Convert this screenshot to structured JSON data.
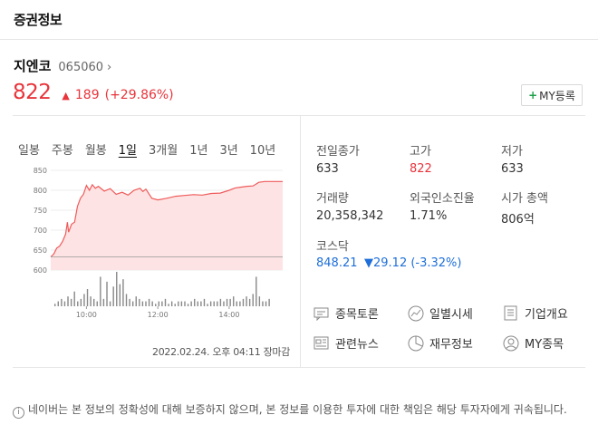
{
  "header": {
    "title": "증권정보"
  },
  "stock": {
    "name": "지엔코",
    "code": "065060",
    "chevron": "›",
    "price": "822",
    "direction_icon": "▲",
    "change": "189",
    "change_pct": "(+29.86%)",
    "my_button": "MY등록",
    "my_button_plus": "+"
  },
  "tabs": [
    "일봉",
    "주봉",
    "월봉",
    "1일",
    "3개월",
    "1년",
    "3년",
    "10년"
  ],
  "active_tab": "1일",
  "chart_data": {
    "type": "area",
    "y_ticks": [
      "850",
      "800",
      "750",
      "700",
      "650",
      "600"
    ],
    "x_ticks": [
      "10:00",
      "12:00",
      "14:00"
    ],
    "ylim": [
      600,
      850
    ],
    "baseline": 633,
    "price_series": [
      {
        "t": "09:00",
        "v": 633
      },
      {
        "t": "09:05",
        "v": 640
      },
      {
        "t": "09:10",
        "v": 655
      },
      {
        "t": "09:15",
        "v": 660
      },
      {
        "t": "09:20",
        "v": 672
      },
      {
        "t": "09:25",
        "v": 690
      },
      {
        "t": "09:28",
        "v": 720
      },
      {
        "t": "09:30",
        "v": 695
      },
      {
        "t": "09:35",
        "v": 715
      },
      {
        "t": "09:40",
        "v": 720
      },
      {
        "t": "09:45",
        "v": 760
      },
      {
        "t": "09:50",
        "v": 780
      },
      {
        "t": "09:55",
        "v": 790
      },
      {
        "t": "10:00",
        "v": 812
      },
      {
        "t": "10:05",
        "v": 800
      },
      {
        "t": "10:10",
        "v": 814
      },
      {
        "t": "10:15",
        "v": 805
      },
      {
        "t": "10:20",
        "v": 810
      },
      {
        "t": "10:30",
        "v": 798
      },
      {
        "t": "10:40",
        "v": 804
      },
      {
        "t": "10:50",
        "v": 790
      },
      {
        "t": "11:00",
        "v": 795
      },
      {
        "t": "11:10",
        "v": 788
      },
      {
        "t": "11:20",
        "v": 800
      },
      {
        "t": "11:30",
        "v": 805
      },
      {
        "t": "11:35",
        "v": 797
      },
      {
        "t": "11:40",
        "v": 803
      },
      {
        "t": "11:50",
        "v": 780
      },
      {
        "t": "12:00",
        "v": 776
      },
      {
        "t": "12:15",
        "v": 780
      },
      {
        "t": "12:30",
        "v": 785
      },
      {
        "t": "12:45",
        "v": 787
      },
      {
        "t": "13:00",
        "v": 789
      },
      {
        "t": "13:15",
        "v": 788
      },
      {
        "t": "13:30",
        "v": 792
      },
      {
        "t": "13:45",
        "v": 793
      },
      {
        "t": "14:00",
        "v": 800
      },
      {
        "t": "14:10",
        "v": 806
      },
      {
        "t": "14:20",
        "v": 808
      },
      {
        "t": "14:30",
        "v": 810
      },
      {
        "t": "14:40",
        "v": 811
      },
      {
        "t": "14:50",
        "v": 820
      },
      {
        "t": "15:00",
        "v": 822
      },
      {
        "t": "15:30",
        "v": 822
      }
    ],
    "volume_series": [
      1,
      2,
      3,
      2,
      4,
      3,
      6,
      2,
      3,
      5,
      7,
      4,
      3,
      2,
      12,
      3,
      10,
      2,
      8,
      14,
      9,
      11,
      5,
      3,
      2,
      4,
      3,
      2,
      2,
      3,
      2,
      1,
      2,
      2,
      3,
      1,
      2,
      1,
      2,
      2,
      2,
      1,
      2,
      3,
      2,
      2,
      3,
      1,
      2,
      2,
      2,
      3,
      2,
      3,
      3,
      4,
      2,
      2,
      3,
      4,
      3,
      5,
      12,
      4,
      2,
      2,
      3
    ]
  },
  "timestamp": "2022.02.24. 오후 04:11 장마감",
  "stats": {
    "prev_close": {
      "label": "전일종가",
      "value": "633"
    },
    "high": {
      "label": "고가",
      "value": "822"
    },
    "low": {
      "label": "저가",
      "value": "633"
    },
    "volume": {
      "label": "거래량",
      "value": "20,358,342"
    },
    "foreign": {
      "label": "외국인소진율",
      "value": "1.71%"
    },
    "market_cap": {
      "label": "시가 총액",
      "value": "806억"
    },
    "index": {
      "label": "코스닥",
      "value": "848.21",
      "change": "▼29.12 (-3.32%)"
    }
  },
  "links": {
    "discussion": "종목토론",
    "daily": "일별시세",
    "company": "기업개요",
    "news": "관련뉴스",
    "financial": "재무정보",
    "my_stocks": "MY종목"
  },
  "notice": "네이버는 본 정보의 정확성에 대해 보증하지 않으며, 본 정보를 이용한 투자에 대한 책임은 해당 투자자에게 귀속됩니다.",
  "notice_icon": "i",
  "colors": {
    "up": "#e8343b",
    "down": "#1e6fd9",
    "chart_fill": "#fde3e3"
  }
}
